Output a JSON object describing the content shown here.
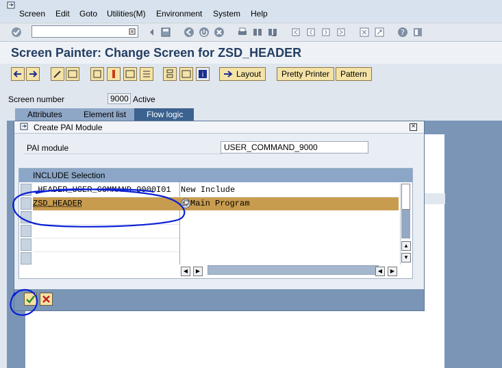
{
  "menubar": {
    "items": [
      "Screen",
      "Edit",
      "Goto",
      "Utilities(M)",
      "Environment",
      "System",
      "Help"
    ]
  },
  "toolbar": {
    "icons": [
      "enter-icon",
      "save-icon",
      "back-icon",
      "exit-icon",
      "cancel-icon",
      "print-icon",
      "find-icon",
      "find-next-icon",
      "first-page-icon",
      "previous-page-icon",
      "next-page-icon",
      "last-page-icon",
      "new-session-icon",
      "shortcut-icon",
      "help-icon",
      "customize-icon"
    ]
  },
  "title": "Screen Painter: Change Screen for ZSD_HEADER",
  "apptoolbar": {
    "layout_label": "Layout",
    "pretty_printer_label": "Pretty Printer",
    "pattern_label": "Pattern"
  },
  "screen": {
    "number_label": "Screen number",
    "number_value": "9000",
    "status": "Active"
  },
  "tabs": [
    "Attributes",
    "Element list",
    "Flow logic"
  ],
  "dialog": {
    "title": "Create PAI Module",
    "pai_label": "PAI module",
    "pai_value": "USER_COMMAND_9000",
    "include_header": "INCLUDE Selection",
    "rows": [
      {
        "name": "_HEADER_USER_COMMAND_9000I01",
        "desc": "New Include",
        "selected": false
      },
      {
        "name": "ZSD_HEADER",
        "desc": "Main Program",
        "selected": true
      }
    ]
  },
  "colors": {
    "title_text": "#233e63",
    "selected_row": "#c89c4f",
    "annotation": "#0a1fd6",
    "dialog_footer": "#7a95b6"
  }
}
